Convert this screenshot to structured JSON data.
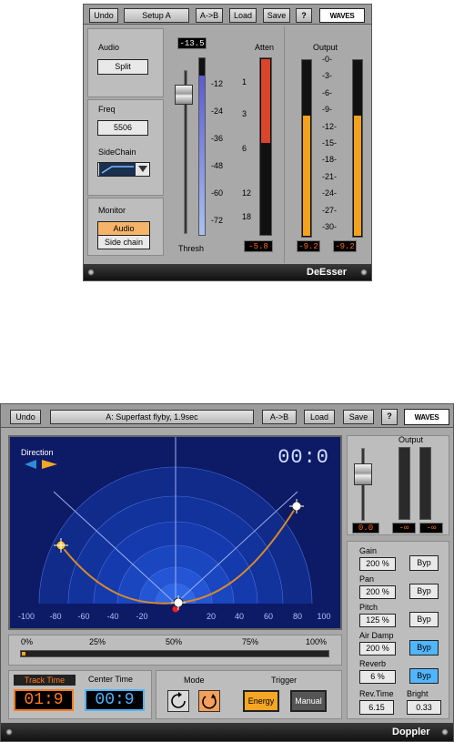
{
  "deesser": {
    "toolbar": {
      "undo": "Undo",
      "setup": "Setup A",
      "ab": "A->B",
      "load": "Load",
      "save": "Save",
      "help": "?",
      "logo": "WAVES"
    },
    "audio_label": "Audio",
    "audio_mode": "Split",
    "freq_label": "Freq",
    "freq_value": "5506",
    "sidechain_label": "SideChain",
    "monitor_label": "Monitor",
    "monitor_audio": "Audio",
    "monitor_sidechain": "Side chain",
    "thresh_value": "-13.5",
    "thresh_label": "Thresh",
    "thresh_scale": [
      "-12",
      "-24",
      "-36",
      "-48",
      "-60",
      "-72"
    ],
    "atten_label": "Atten",
    "atten_scale": [
      "1",
      "3",
      "6",
      "12",
      "18"
    ],
    "atten_value": "-5.8",
    "output_label": "Output",
    "output_scale": [
      "-0-",
      "-3-",
      "-6-",
      "-9-",
      "-12-",
      "-15-",
      "-18-",
      "-21-",
      "-24-",
      "-27-",
      "-30-"
    ],
    "output_left": "-9.2",
    "output_right": "-9.2",
    "plugin_name": "DeEsser",
    "colors": {
      "atten_fill": "#d9442b",
      "output_fill": "#f2a21c",
      "thresh_fill": "#8e8fd9"
    }
  },
  "doppler": {
    "toolbar": {
      "undo": "Undo",
      "preset": "A: Superfast flyby, 1.9sec",
      "ab": "A->B",
      "load": "Load",
      "save": "Save",
      "help": "?",
      "logo": "WAVES"
    },
    "direction_label": "Direction",
    "time_display": "00:0",
    "x_axis": [
      "-100",
      "-80",
      "-60",
      "-40",
      "-20",
      "20",
      "40",
      "60",
      "80",
      "100"
    ],
    "progress_ticks": [
      "0%",
      "25%",
      "50%",
      "75%",
      "100%"
    ],
    "track_time_label": "Track Time",
    "track_time_value": "01:9",
    "center_time_label": "Center Time",
    "center_time_value": "00:9",
    "mode_label": "Mode",
    "trigger_label": "Trigger",
    "trigger_energy": "Energy",
    "trigger_manual": "Manual",
    "output_label": "Output",
    "output_gain": "0.0",
    "output_left": "-∞",
    "output_right": "-∞",
    "params": [
      {
        "label": "Gain",
        "value": "200 %",
        "byp": "Byp",
        "active": false
      },
      {
        "label": "Pan",
        "value": "200 %",
        "byp": "Byp",
        "active": false
      },
      {
        "label": "Pitch",
        "value": "125 %",
        "byp": "Byp",
        "active": false
      },
      {
        "label": "Air Damp",
        "value": "200 %",
        "byp": "Byp",
        "active": true
      },
      {
        "label": "Reverb",
        "value": "6 %",
        "byp": "Byp",
        "active": true
      }
    ],
    "rev_time_label": "Rev.Time",
    "rev_time_value": "6.15",
    "bright_label": "Bright",
    "bright_value": "0.33",
    "plugin_name": "Doppler",
    "colors": {
      "byp_active": "#4fb6ff",
      "track_accent": "#ff7a1a",
      "path": "#d98a2a"
    }
  }
}
